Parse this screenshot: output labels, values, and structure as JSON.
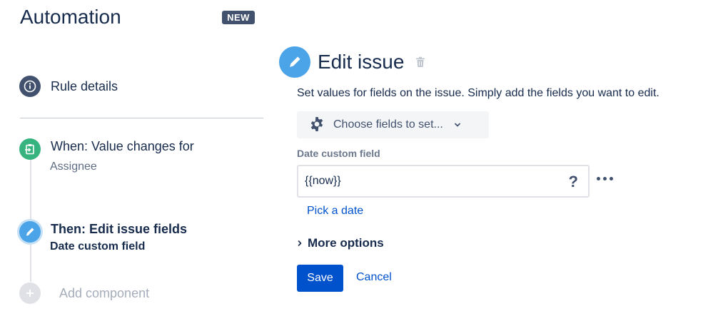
{
  "header": {
    "title": "Automation",
    "badge": "NEW"
  },
  "sidebar": {
    "rule_details": {
      "label": "Rule details",
      "icon": "info-icon"
    },
    "steps": [
      {
        "title": "When: Value changes for",
        "subtitle": "Assignee",
        "icon": "trigger-icon",
        "color": "#36b37e"
      },
      {
        "title": "Then: Edit issue fields",
        "subtitle": "Date custom field",
        "icon": "pencil-icon",
        "color": "#4ba3e8"
      }
    ],
    "add_component": {
      "label": "Add component",
      "icon": "plus-icon"
    }
  },
  "editor": {
    "title": "Edit issue",
    "description": "Set values for fields on the issue. Simply add the fields you want to edit.",
    "choose_fields": {
      "label": "Choose fields to set...",
      "icon": "gear-icon"
    },
    "field": {
      "label": "Date custom field",
      "value": "{{now}}",
      "help": "?"
    },
    "pick_date": "Pick a date",
    "more_options": "More options",
    "actions": {
      "save": "Save",
      "cancel": "Cancel"
    }
  },
  "colors": {
    "primary": "#0052cc",
    "text": "#172b4d",
    "secondary_text": "#6b778c",
    "trigger": "#36b37e",
    "action": "#4ba3e8"
  }
}
